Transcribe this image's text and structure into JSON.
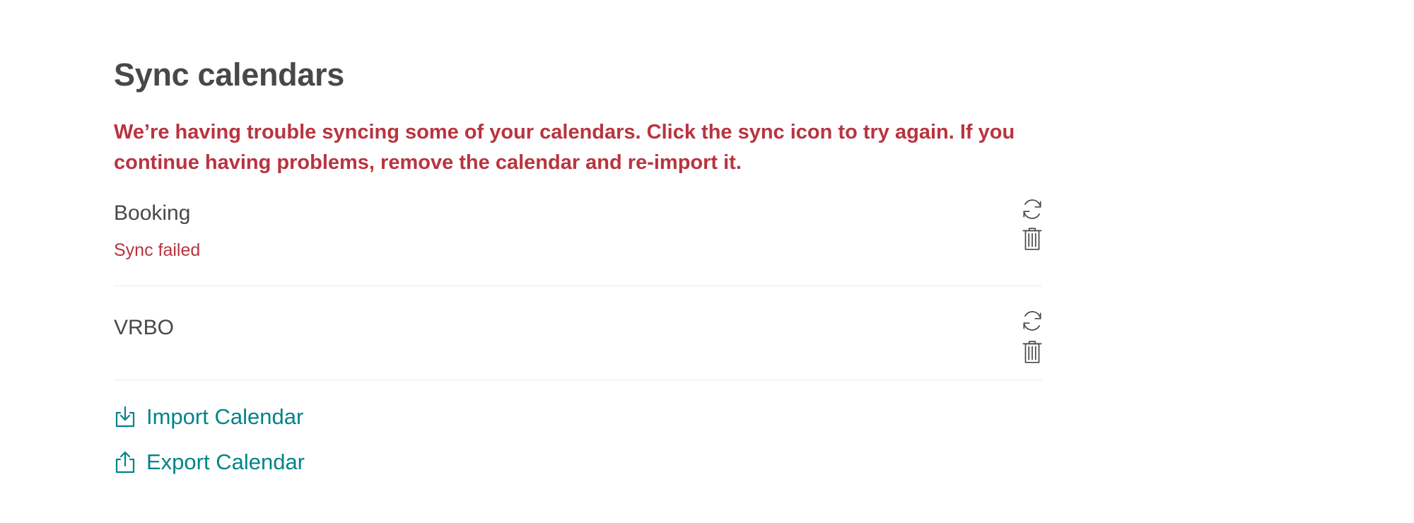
{
  "page": {
    "title": "Sync calendars",
    "error_message": "We’re having trouble syncing some of your calendars. Click the sync icon to try again. If you continue having problems, remove the calendar and re-import it."
  },
  "calendars": [
    {
      "name": "Booking",
      "status": "Sync failed"
    },
    {
      "name": "VRBO",
      "status": ""
    }
  ],
  "actions": {
    "import_label": "Import Calendar",
    "export_label": "Export Calendar"
  },
  "icons": {
    "sync": "sync-icon",
    "delete": "trash-icon",
    "import": "import-icon",
    "export": "export-icon"
  },
  "colors": {
    "heading": "#484848",
    "error": "#b8343f",
    "link": "#00848a",
    "divider": "#ebebeb"
  }
}
